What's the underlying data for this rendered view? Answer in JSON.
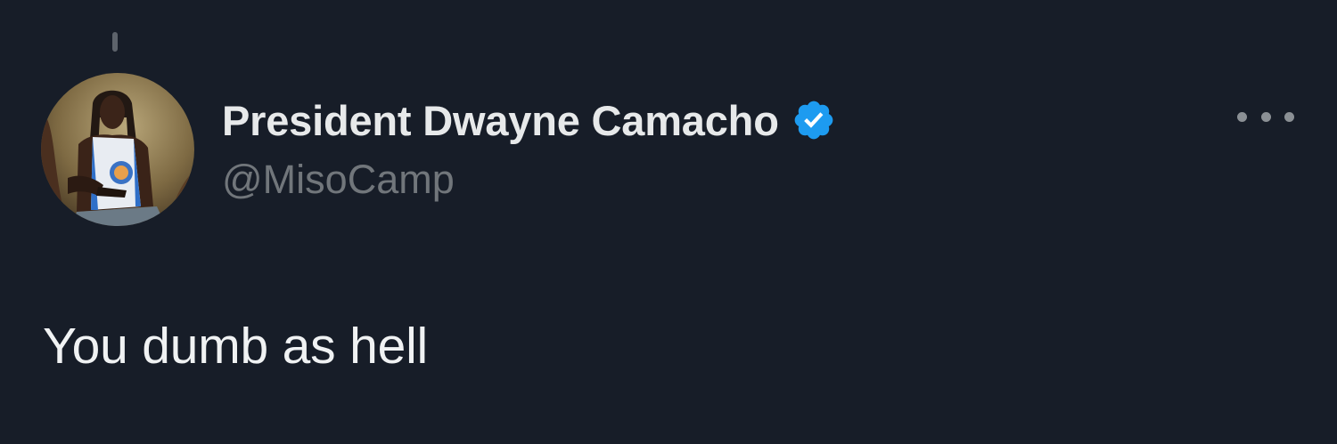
{
  "tweet": {
    "author": {
      "display_name": "President Dwayne Camacho",
      "handle": "@MisoCamp",
      "verified": true,
      "verified_badge_icon": "verified-badge-icon",
      "verified_color": "#1d9bf0",
      "avatar_icon": "profile-avatar"
    },
    "text": "You dumb as hell",
    "more_icon": "more-options-icon"
  },
  "theme": {
    "background": "#171d28",
    "primary_text": "#e7e9ea",
    "secondary_text": "#71767b"
  }
}
